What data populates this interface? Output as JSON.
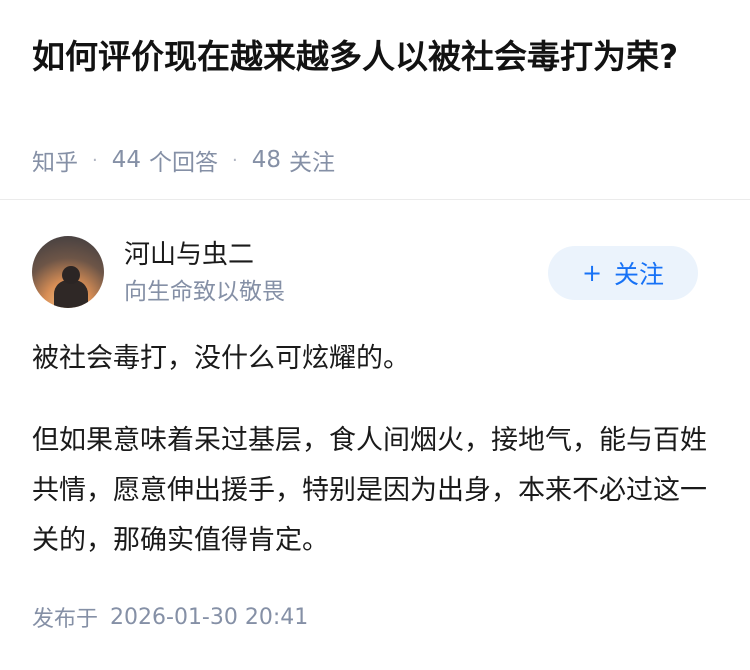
{
  "question": {
    "title": "如何评价现在越来越多人以被社会毒打为荣?",
    "source": "知乎",
    "answer_count": "44",
    "answer_label": "个回答",
    "follower_count": "48",
    "follower_label": "关注"
  },
  "author": {
    "name": "河山与虫二",
    "signature": "向生命致以敬畏",
    "follow_plus": "+",
    "follow_label": "关注"
  },
  "answer": {
    "paragraphs": [
      "被社会毒打，没什么可炫耀的。",
      "但如果意味着呆过基层，食人间烟火，接地气，能与百姓共情，愿意伸出援手，特别是因为出身，本来不必过这一关的，那确实值得肯定。"
    ]
  },
  "publish": {
    "label": "发布于",
    "datetime": "2026-01-30 20:41"
  },
  "colors": {
    "accent": "#1772f6",
    "meta_gray": "#8590a6",
    "follow_bg": "#ebf3fc"
  }
}
